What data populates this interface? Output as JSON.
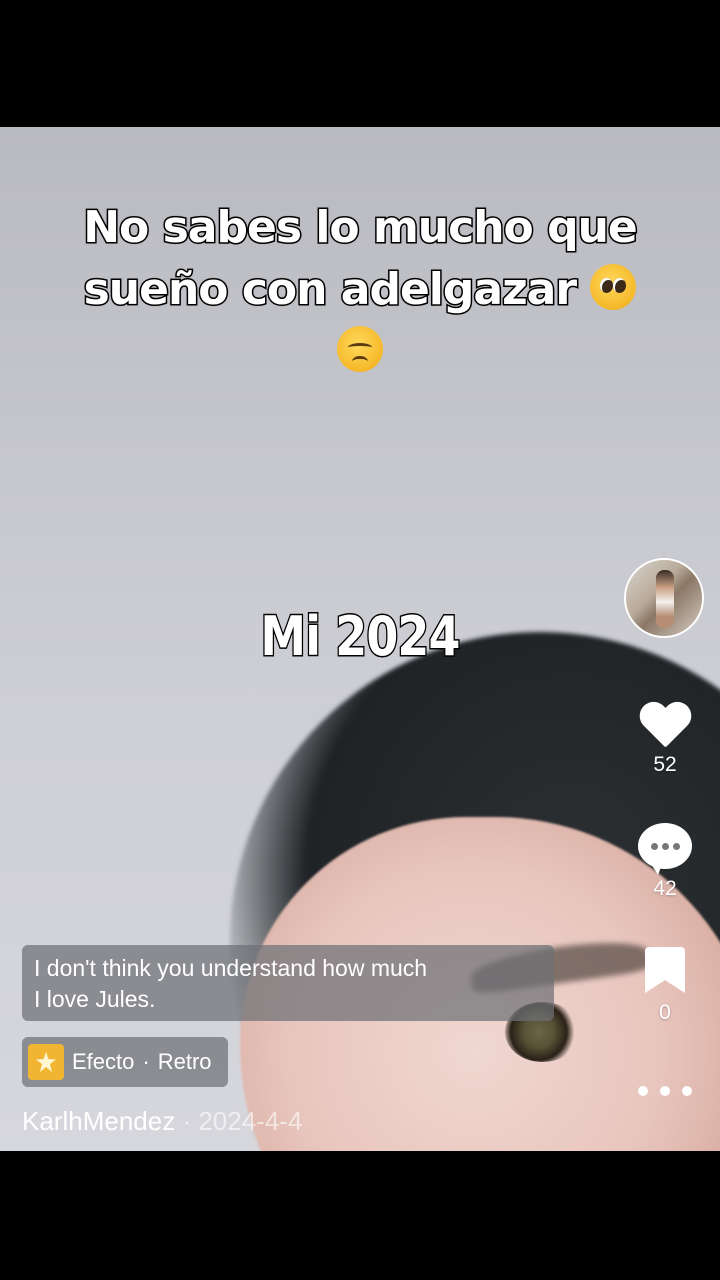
{
  "overlay": {
    "headline_line1": "No sabes lo mucho que",
    "headline_line2": "sueño con adelgazar",
    "center_caption": "Mi 2024"
  },
  "icons": {
    "emoji1": "pleading-face-emoji",
    "emoji2": "disappointed-face-emoji"
  },
  "actions": {
    "likes": "52",
    "comments": "42",
    "saves": "0"
  },
  "lyric": {
    "line1": "I don't think you understand how much",
    "line2": "I love Jules."
  },
  "effect": {
    "label": "Efecto",
    "separator": "·",
    "name": "Retro"
  },
  "author": {
    "username": "KarlhMendez",
    "separator": "·",
    "date": "2024-4-4"
  },
  "colors": {
    "background": "#000000",
    "effect_icon": "#f2b531"
  }
}
